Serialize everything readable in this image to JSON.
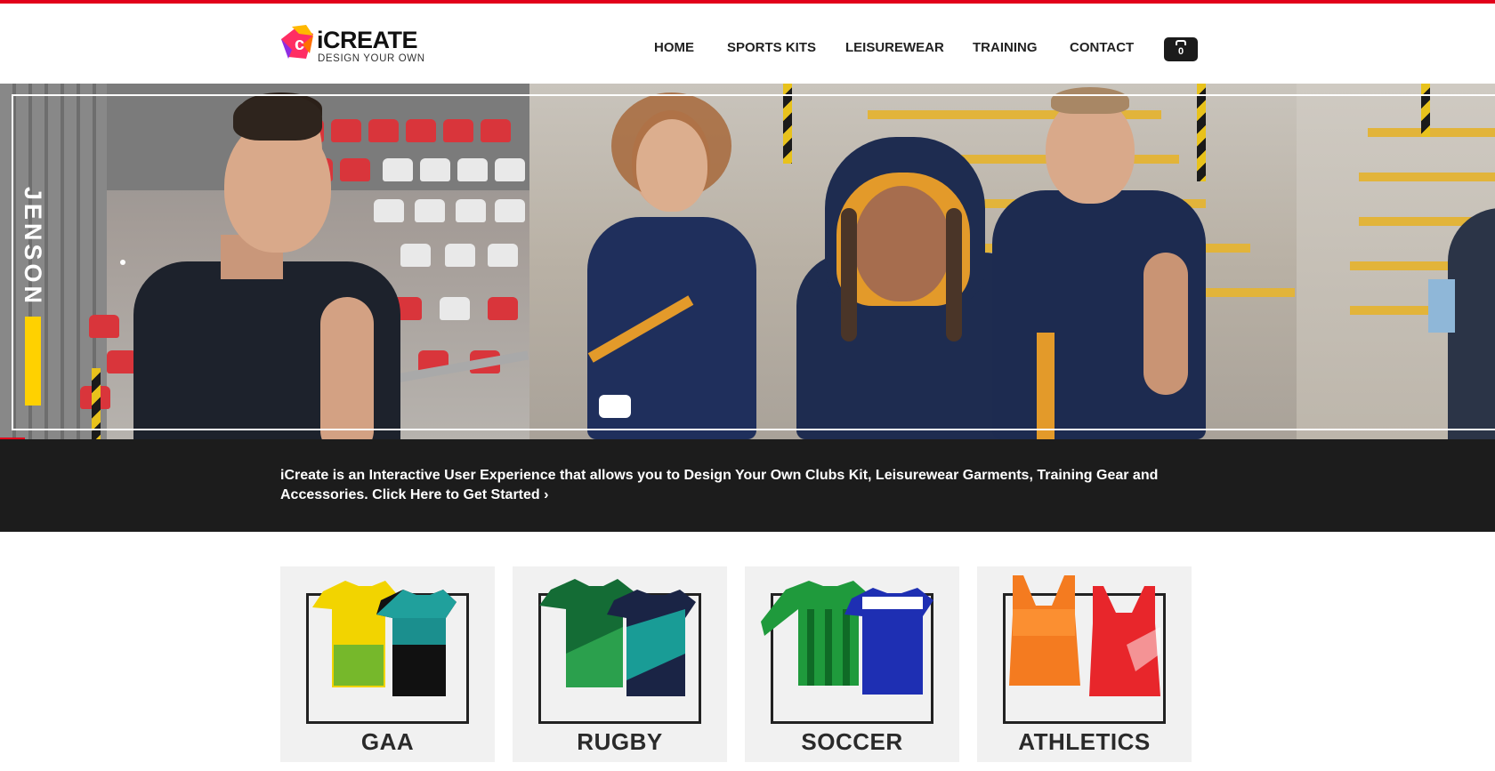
{
  "header": {
    "logo_text": "iCREATE",
    "logo_tagline": "DESIGN YOUR OWN",
    "nav": [
      {
        "label": "HOME"
      },
      {
        "label": "SPORTS KITS"
      },
      {
        "label": "LEISUREWEAR"
      },
      {
        "label": "TRAINING"
      },
      {
        "label": "CONTACT"
      }
    ],
    "cart_count": "0"
  },
  "hero": {
    "brand": "JENSON",
    "slides_total": 4,
    "active_slide": 1
  },
  "intro": {
    "text": "iCreate is an Interactive User Experience that allows you to Design Your Own Clubs Kit, Leisurewear Garments, Training Gear and Accessories. Click Here to Get Started ›"
  },
  "categories": [
    {
      "label": "GAA"
    },
    {
      "label": "RUGBY"
    },
    {
      "label": "SOCCER"
    },
    {
      "label": "ATHLETICS"
    }
  ],
  "colors": {
    "accent_red": "#e2001a",
    "brand_yellow": "#ffd100",
    "dark_band": "#1c1c1c"
  }
}
